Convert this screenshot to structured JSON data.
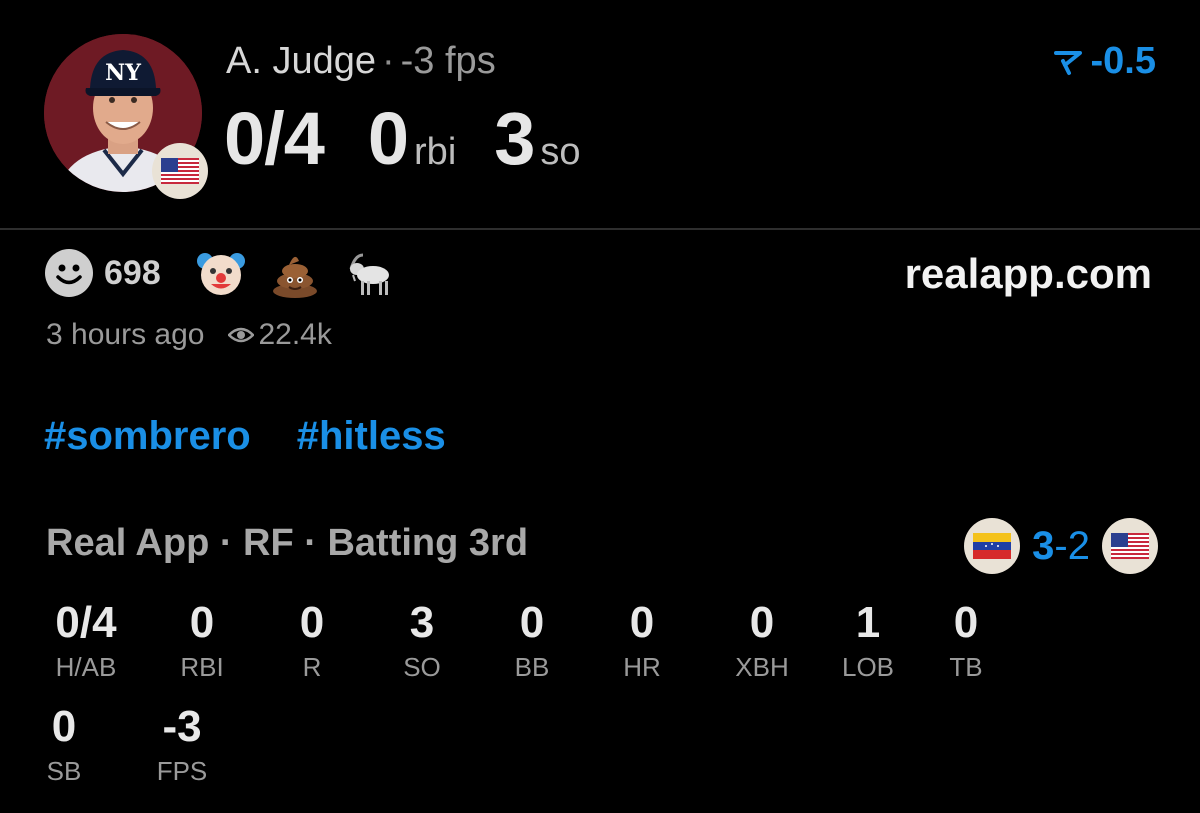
{
  "player": {
    "name": "A. Judge",
    "separator": "·",
    "fps": "-3 fps",
    "hits_ab": "0/4",
    "rbi": "0",
    "rbi_unit": "rbi",
    "so": "3",
    "so_unit": "so",
    "avatar_icon": "player-portrait",
    "flag_icon": "usa-flag-icon"
  },
  "line": {
    "value": "-0.5",
    "icon": "line-direction-icon",
    "color": "#1a8fe6"
  },
  "reactions": {
    "count": "698",
    "icons": [
      "smiley-icon",
      "clown-icon",
      "poop-icon",
      "goat-icon"
    ]
  },
  "site": "realapp.com",
  "meta": {
    "time": "3 hours ago",
    "views": "22.4k"
  },
  "tags": [
    "#sombrero",
    "#hitless"
  ],
  "game": {
    "line": "Real App · RF · Batting 3rd",
    "score_home": "3",
    "score_sep": "-",
    "score_away": "2",
    "home_flag": "venezuela-flag-icon",
    "away_flag": "usa-flag-icon"
  },
  "box": [
    {
      "label": "H/AB",
      "value": "0/4"
    },
    {
      "label": "RBI",
      "value": "0"
    },
    {
      "label": "R",
      "value": "0"
    },
    {
      "label": "SO",
      "value": "3"
    },
    {
      "label": "BB",
      "value": "0"
    },
    {
      "label": "HR",
      "value": "0"
    },
    {
      "label": "XBH",
      "value": "0"
    },
    {
      "label": "LOB",
      "value": "1"
    },
    {
      "label": "TB",
      "value": "0"
    },
    {
      "label": "SB",
      "value": "0"
    },
    {
      "label": "FPS",
      "value": "-3"
    }
  ]
}
